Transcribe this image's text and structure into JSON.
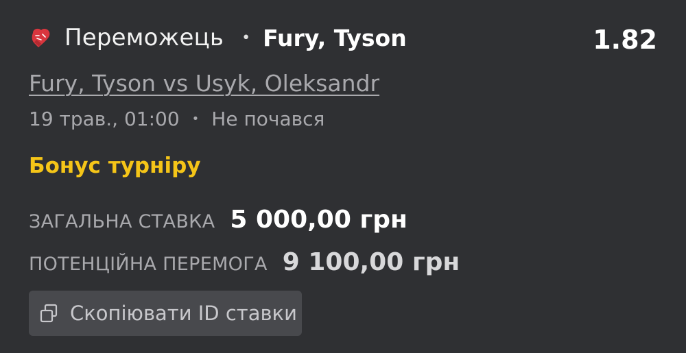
{
  "bet": {
    "sport_icon": "boxing-glove-icon",
    "market": "Переможець",
    "selection": "Fury, Tyson",
    "odds": "1.82",
    "event_name": "Fury, Tyson vs Usyk, Oleksandr",
    "date": "19 трав., 01:00",
    "status": "Не почався",
    "bonus_label": "Бонус турніру",
    "total_stake_label": "ЗАГАЛЬНА СТАВКА",
    "total_stake_value": "5 000,00 грн",
    "potential_win_label": "ПОТЕНЦІЙНА ПЕРЕМОГА",
    "potential_win_value": "9 100,00 грн",
    "copy_button_label": "Скопіювати ID ставки",
    "copy_icon": "copy-icon"
  },
  "colors": {
    "background": "#2f3033",
    "bonus": "#f5c518",
    "button_bg": "#48494d",
    "muted_text": "#a9a9ad",
    "icon_red": "#d9363e"
  }
}
